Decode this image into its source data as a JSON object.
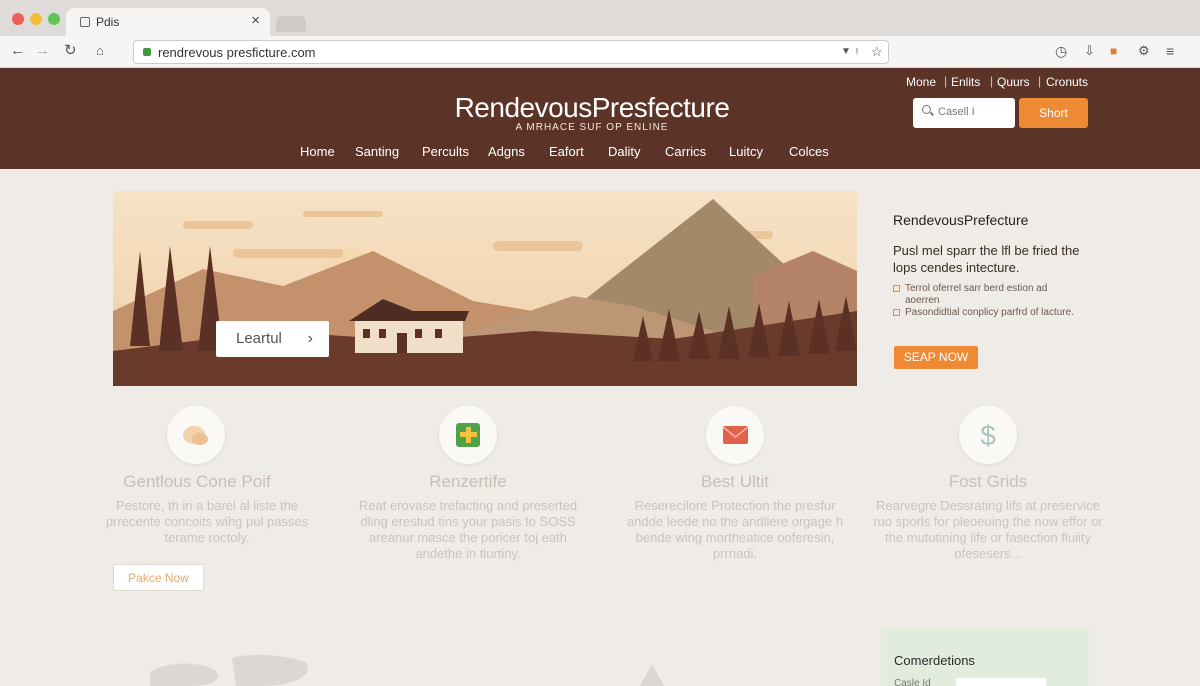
{
  "browser": {
    "tab_title": "Pdis",
    "url": "rendrevous presficture.com"
  },
  "header": {
    "util_links": [
      "Mone",
      "Enlits",
      "Quurs",
      "Cronuts"
    ],
    "search_placeholder": "Casell I",
    "search_button": "Short",
    "logo": "RendevousPresfecture",
    "tagline": "A MRHACE SUF OP ENLINE",
    "nav": [
      "Home",
      "Santing",
      "Percults",
      "Adgns",
      "Eafort",
      "Dality",
      "Carrics",
      "Luitcy",
      "Colces"
    ]
  },
  "hero": {
    "button_label": "Leartul"
  },
  "sidebar": {
    "title": "RendevousPrefecture",
    "description": "Pusl mel sparr the lfl be fried the lops cendes intecture.",
    "bullets": [
      "Terrol oferrel sarr berd estion ad aoerren",
      "Pasondidtial conplicy parfrd of lacture."
    ],
    "button": "SEAP NOW"
  },
  "features": [
    {
      "icon": "leaf-icon",
      "title": "Gentlous Cone Poif",
      "description": "Pestore, th in a barel al liste the prrecente concoits wihg pul passes terame roctoly."
    },
    {
      "icon": "shield-plus-icon",
      "title": "Renzertife",
      "description": "Reat erovase trefacting and preserted dling erestud tins your pasis to SOSS areanur masce the poricer toj eath andethe in tlurtiny."
    },
    {
      "icon": "envelope-icon",
      "title": "Best Ultit",
      "description": "Reserecilore Protection the presfur andde leede no the andliere orgage h bende wing mortheatice ooferesin, prrnadi."
    },
    {
      "icon": "dollar-icon",
      "title": "Fost Grids",
      "description": "Rearvegre Dessrating lifs at preservice ruo sporls for pleoeuing the now effor or the mututining life or fasection fluiity ofesesers..."
    }
  ],
  "feature_button": "Pakce Now",
  "contact": {
    "title": "Comerdetions",
    "field_label": "Casle Id"
  }
}
